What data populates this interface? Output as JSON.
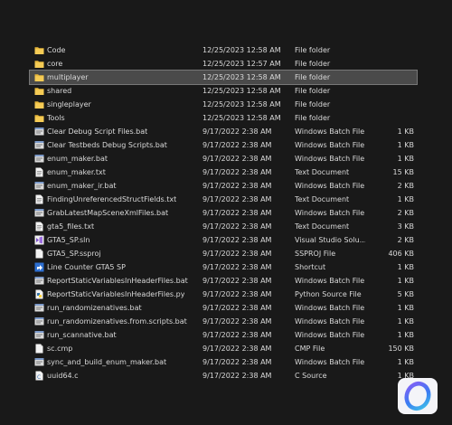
{
  "files": [
    {
      "name": "Code",
      "date": "12/25/2023 12:58 AM",
      "type": "File folder",
      "size": "",
      "icon": "folder-icon"
    },
    {
      "name": "core",
      "date": "12/25/2023 12:57 AM",
      "type": "File folder",
      "size": "",
      "icon": "folder-icon"
    },
    {
      "name": "multiplayer",
      "date": "12/25/2023 12:58 AM",
      "type": "File folder",
      "size": "",
      "icon": "folder-icon",
      "selected": true
    },
    {
      "name": "shared",
      "date": "12/25/2023 12:58 AM",
      "type": "File folder",
      "size": "",
      "icon": "folder-icon"
    },
    {
      "name": "singleplayer",
      "date": "12/25/2023 12:58 AM",
      "type": "File folder",
      "size": "",
      "icon": "folder-icon"
    },
    {
      "name": "Tools",
      "date": "12/25/2023 12:58 AM",
      "type": "File folder",
      "size": "",
      "icon": "folder-icon"
    },
    {
      "name": "Clear Debug Script Files.bat",
      "date": "9/17/2022 2:38 AM",
      "type": "Windows Batch File",
      "size": "1 KB",
      "icon": "batch-file-icon"
    },
    {
      "name": "Clear Testbeds Debug Scripts.bat",
      "date": "9/17/2022 2:38 AM",
      "type": "Windows Batch File",
      "size": "1 KB",
      "icon": "batch-file-icon"
    },
    {
      "name": "enum_maker.bat",
      "date": "9/17/2022 2:38 AM",
      "type": "Windows Batch File",
      "size": "1 KB",
      "icon": "batch-file-icon"
    },
    {
      "name": "enum_maker.txt",
      "date": "9/17/2022 2:38 AM",
      "type": "Text Document",
      "size": "15 KB",
      "icon": "text-file-icon"
    },
    {
      "name": "enum_maker_ir.bat",
      "date": "9/17/2022 2:38 AM",
      "type": "Windows Batch File",
      "size": "2 KB",
      "icon": "batch-file-icon"
    },
    {
      "name": "FindingUnreferencedStructFields.txt",
      "date": "9/17/2022 2:38 AM",
      "type": "Text Document",
      "size": "1 KB",
      "icon": "text-file-icon"
    },
    {
      "name": "GrabLatestMapSceneXmlFiles.bat",
      "date": "9/17/2022 2:38 AM",
      "type": "Windows Batch File",
      "size": "2 KB",
      "icon": "batch-file-icon"
    },
    {
      "name": "gta5_files.txt",
      "date": "9/17/2022 2:38 AM",
      "type": "Text Document",
      "size": "3 KB",
      "icon": "text-file-icon"
    },
    {
      "name": "GTA5_SP.sln",
      "date": "9/17/2022 2:38 AM",
      "type": "Visual Studio Solu...",
      "size": "2 KB",
      "icon": "visual-studio-solution-icon"
    },
    {
      "name": "GTA5_SP.ssproj",
      "date": "9/17/2022 2:38 AM",
      "type": "SSPROJ File",
      "size": "406 KB",
      "icon": "generic-file-icon"
    },
    {
      "name": "Line Counter GTA5 SP",
      "date": "9/17/2022 2:38 AM",
      "type": "Shortcut",
      "size": "1 KB",
      "icon": "shortcut-icon"
    },
    {
      "name": "ReportStaticVariablesInHeaderFiles.bat",
      "date": "9/17/2022 2:38 AM",
      "type": "Windows Batch File",
      "size": "1 KB",
      "icon": "batch-file-icon"
    },
    {
      "name": "ReportStaticVariablesInHeaderFiles.py",
      "date": "9/17/2022 2:38 AM",
      "type": "Python Source File",
      "size": "5 KB",
      "icon": "python-file-icon"
    },
    {
      "name": "run_randomizenatives.bat",
      "date": "9/17/2022 2:38 AM",
      "type": "Windows Batch File",
      "size": "1 KB",
      "icon": "batch-file-icon"
    },
    {
      "name": "run_randomizenatives.from.scripts.bat",
      "date": "9/17/2022 2:38 AM",
      "type": "Windows Batch File",
      "size": "1 KB",
      "icon": "batch-file-icon"
    },
    {
      "name": "run_scannative.bat",
      "date": "9/17/2022 2:38 AM",
      "type": "Windows Batch File",
      "size": "1 KB",
      "icon": "batch-file-icon"
    },
    {
      "name": "sc.cmp",
      "date": "9/17/2022 2:38 AM",
      "type": "CMP File",
      "size": "150 KB",
      "icon": "generic-file-icon"
    },
    {
      "name": "sync_and_build_enum_maker.bat",
      "date": "9/17/2022 2:38 AM",
      "type": "Windows Batch File",
      "size": "1 KB",
      "icon": "batch-file-icon"
    },
    {
      "name": "uuid64.c",
      "date": "9/17/2022 2:38 AM",
      "type": "C Source",
      "size": "1 KB",
      "icon": "c-source-file-icon"
    }
  ],
  "colors": {
    "background": "#191919",
    "text": "#d9d9d9",
    "selected_row": "#4a4a4a",
    "folder": "#e8b73a",
    "logo_gradient": [
      "#8a5cf6",
      "#3b7cf2",
      "#3ec6e8"
    ]
  }
}
